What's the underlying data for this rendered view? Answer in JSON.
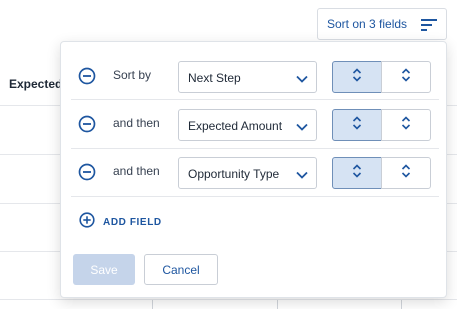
{
  "background_table": {
    "column_header": "Expected"
  },
  "sort_trigger": {
    "label": "Sort on 3 fields",
    "icon": "sort-lines-icon"
  },
  "sort_panel": {
    "rows": [
      {
        "prefix": "Sort by",
        "field": "Next Step",
        "direction": "ascending"
      },
      {
        "prefix": "and then",
        "field": "Expected Amount",
        "direction": "ascending"
      },
      {
        "prefix": "and then",
        "field": "Opportunity Type",
        "direction": "ascending"
      }
    ],
    "add_field_label": "ADD FIELD",
    "save_label": "Save",
    "cancel_label": "Cancel"
  },
  "colors": {
    "accent": "#1e56a0",
    "selected_bg": "#d6e3f3",
    "disabled_btn": "#c5d4ea",
    "border": "#c9ced6"
  }
}
